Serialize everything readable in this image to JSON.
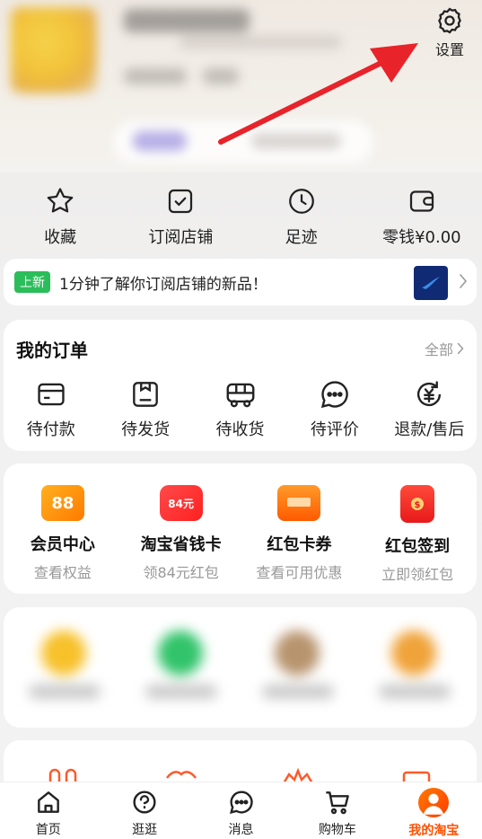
{
  "settings": {
    "label": "设置"
  },
  "quick": [
    {
      "label": "收藏",
      "icon": "star-icon"
    },
    {
      "label": "订阅店铺",
      "icon": "checkbox-icon"
    },
    {
      "label": "足迹",
      "icon": "clock-icon"
    },
    {
      "label": "零钱¥0.00",
      "icon": "wallet-icon"
    }
  ],
  "notice": {
    "tag": "上新",
    "text": "1分钟了解你订阅店铺的新品！"
  },
  "orders": {
    "title": "我的订单",
    "all_label": "全部",
    "items": [
      {
        "label": "待付款",
        "icon": "card-icon"
      },
      {
        "label": "待发货",
        "icon": "package-icon"
      },
      {
        "label": "待收货",
        "icon": "truck-icon"
      },
      {
        "label": "待评价",
        "icon": "chat-icon"
      },
      {
        "label": "退款/售后",
        "icon": "refund-icon"
      }
    ]
  },
  "benefits": [
    {
      "label": "会员中心",
      "sub": "查看权益",
      "badge": "88",
      "color": "#ff8a00"
    },
    {
      "label": "淘宝省钱卡",
      "sub": "领84元红包",
      "badge": "84元",
      "color": "#ff2d2d"
    },
    {
      "label": "红包卡券",
      "sub": "查看可用优惠",
      "badge": "",
      "color": "#ff6a00"
    },
    {
      "label": "红包签到",
      "sub": "立即领红包",
      "badge": "",
      "color": "#ff2a2a"
    }
  ],
  "tabbar": [
    {
      "label": "首页",
      "icon": "home-icon"
    },
    {
      "label": "逛逛",
      "icon": "explore-icon"
    },
    {
      "label": "消息",
      "icon": "message-icon"
    },
    {
      "label": "购物车",
      "icon": "cart-icon"
    },
    {
      "label": "我的淘宝",
      "icon": "profile-icon",
      "active": true
    }
  ],
  "colors": {
    "accent": "#ff5000",
    "green_tag": "#2bbd5a"
  }
}
